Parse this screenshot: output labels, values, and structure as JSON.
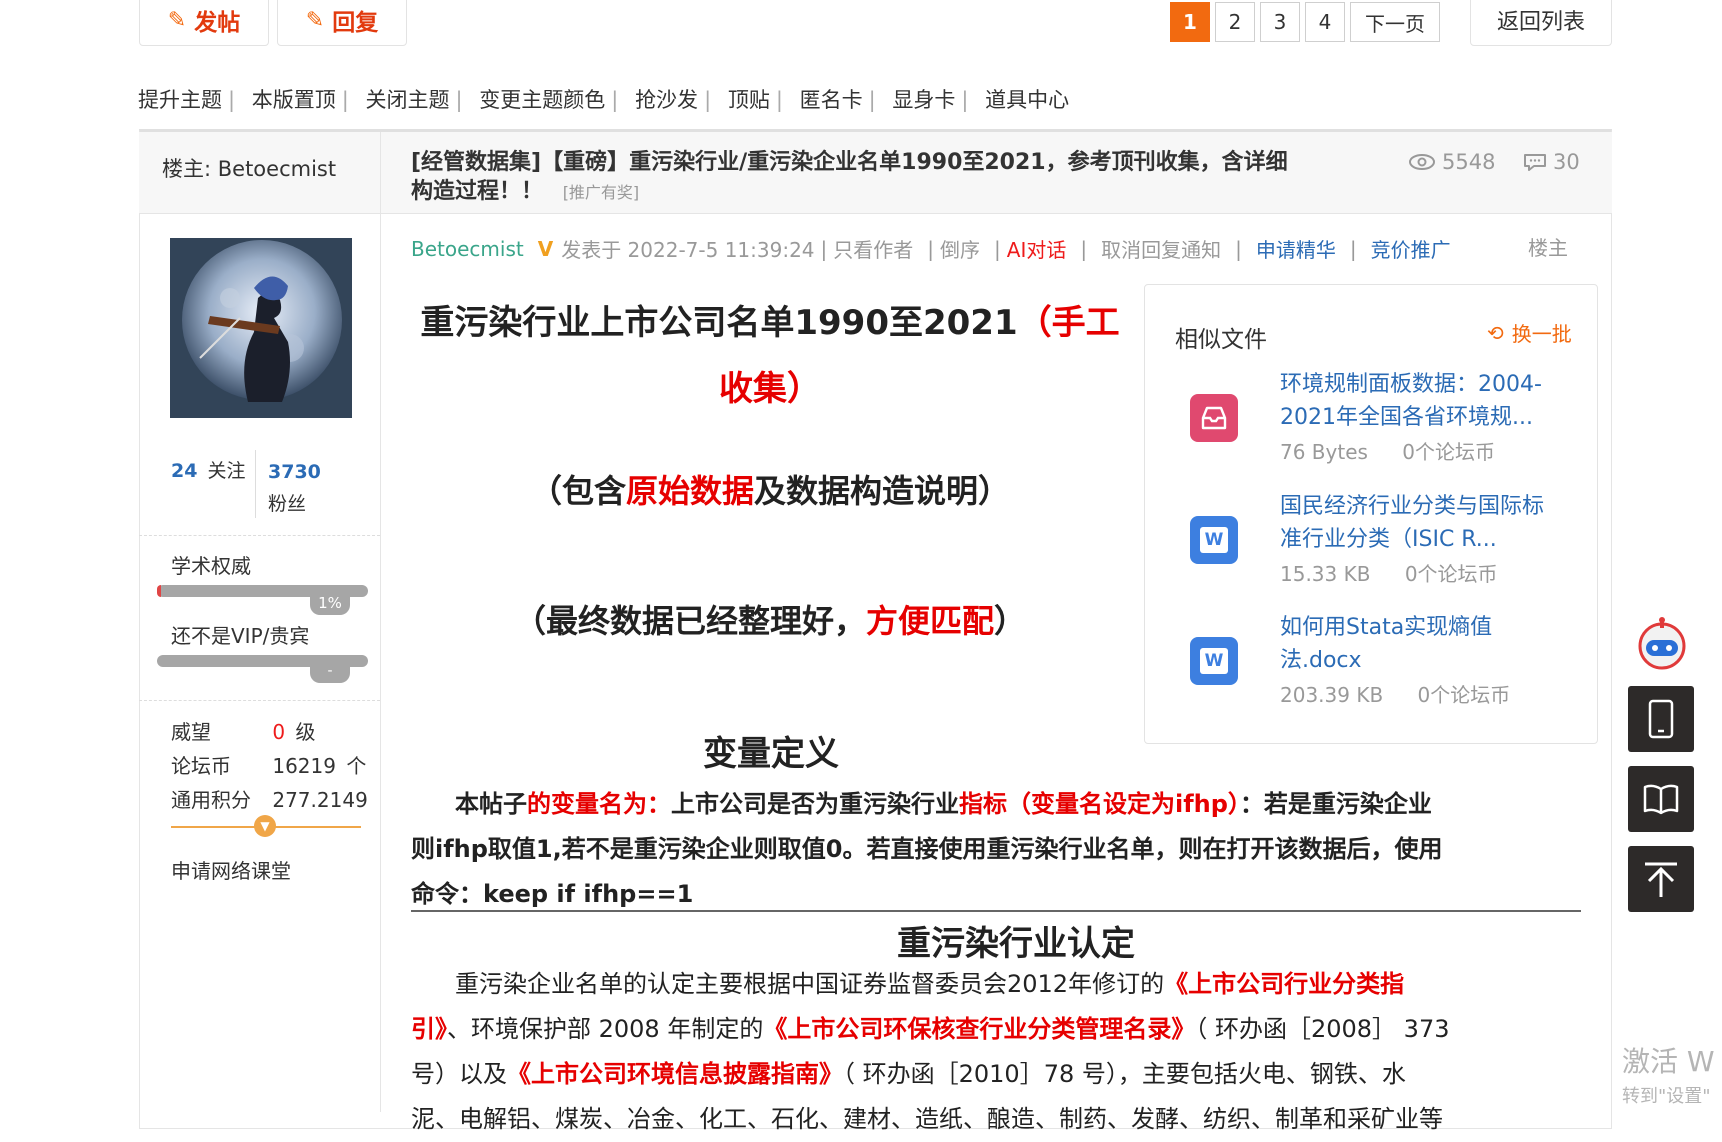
{
  "actions": {
    "new_post_label": "发帖",
    "reply_label": "回复",
    "back_to_list": "返回列表"
  },
  "pagination": {
    "pages": [
      "1",
      "2",
      "3",
      "4"
    ],
    "current": "1",
    "next_label": "下一页"
  },
  "toolbar": {
    "items": [
      "提升主题",
      "本版置顶",
      "关闭主题",
      "变更主题颜色",
      "抢沙发",
      "顶贴",
      "匿名卡",
      "显身卡",
      "道具中心"
    ]
  },
  "thread": {
    "author_label": "楼主: Betoecmist",
    "title_line1": "[经管数据集]【重磅】重污染行业/重污染企业名单1990至2021，参考顶刊收集，含详细",
    "title_line2": "构造过程！！",
    "title_tag": "[推广有奖]",
    "views": "5548",
    "replies": "30"
  },
  "user": {
    "following_count": "24",
    "following_label": "关注",
    "followers_count": "3730",
    "followers_label": "粉丝",
    "academic_label": "学术权威",
    "academic_percent_label": "1%",
    "academic_progress": 0.01,
    "vip_label": "还不是VIP/贵宾",
    "vip_badge": "-",
    "prestige_label": "威望",
    "prestige_value": "0",
    "prestige_unit": "级",
    "coins_label": "论坛币",
    "coins_value": "16219",
    "coins_unit": "个",
    "points_label": "通用积分",
    "points_value": "277.2149",
    "apply_course": "申请网络课堂"
  },
  "post_meta": {
    "author": "Betoecmist",
    "posted_at": "发表于 2022-7-5 11:39:24",
    "only_author": "只看作者",
    "reverse": "倒序",
    "ai_chat": "AI对话",
    "cancel_notice": "取消回复通知",
    "apply_digest": "申请精华",
    "bid_promo": "竞价推广",
    "floor": "楼主"
  },
  "content": {
    "headline_black": "重污染行业上市公司名单1990至2021",
    "headline_red_1": "（手工",
    "headline_red_2": "收集）",
    "sub1_a": "（包含",
    "sub1_red": "原始数据",
    "sub1_b": "及数据构造说明）",
    "sub2_a": "（最终数据已经整理好，",
    "sub2_red": "方便匹配",
    "sub2_b": "）",
    "var_heading": "变量定义",
    "var_p_a": "本帖子",
    "var_p_red1": "的变量名为：",
    "var_p_b": "上市公司是否为重污染行业",
    "var_p_red2": "指标（变量名设定为ifhp）",
    "var_p_c": "：若是重污染企业",
    "var_p_line2": "则ifhp取值1,若不是重污染企业则取值0。若直接使用重污染行业名单，则在打开该数据后，使用",
    "var_p_line3": "命令：keep if ifhp==1",
    "ind_heading": "重污染行业认定",
    "ind_p1_a": "重污染企业名单的认定主要根据中国证券监督委员会2012年修订的",
    "ind_p1_red": "《上市公司行业分类指",
    "ind_p2_red1": "引》",
    "ind_p2_a": "、环境保护部 2008 年制定的",
    "ind_p2_red2": "《上市公司环保核查行业分类管理名录》",
    "ind_p2_b": "（ 环办函［2008］ 373",
    "ind_p3_a": "号）以及",
    "ind_p3_red": "《上市公司环境信息披露指南》",
    "ind_p3_b": "（ 环办函［2010］78 号），主要包括火电、钢铁、水",
    "ind_p4": "泥、电解铝、煤炭、冶金、化工、石化、建材、造纸、酿造、制药、发酵、纺织、制革和采矿业等"
  },
  "similar": {
    "title": "相似文件",
    "refresh_label": "换一批",
    "files": [
      {
        "name_line1": "环境规制面板数据：2004-",
        "name_line2": "2021年全国各省环境规...",
        "size": "76 Bytes",
        "price": "0个论坛币",
        "icon": "archive-icon"
      },
      {
        "name_line1": "国民经济行业分类与国际标",
        "name_line2": "准行业分类（ISIC R...",
        "size": "15.33 KB",
        "price": "0个论坛币",
        "icon": "word-icon"
      },
      {
        "name_line1": "如何用Stata实现熵值",
        "name_line2": "法.docx",
        "size": "203.39 KB",
        "price": "0个论坛币",
        "icon": "word-icon"
      }
    ]
  },
  "watermark": {
    "line1": "激活 W",
    "line2": "转到\"设置\""
  },
  "colors": {
    "accent_orange": "#f26a10",
    "link_blue": "#2b6bb5",
    "text_red": "#ee1b1b",
    "author_green": "#3aa58a",
    "side_button_dark": "#2d2a29"
  }
}
